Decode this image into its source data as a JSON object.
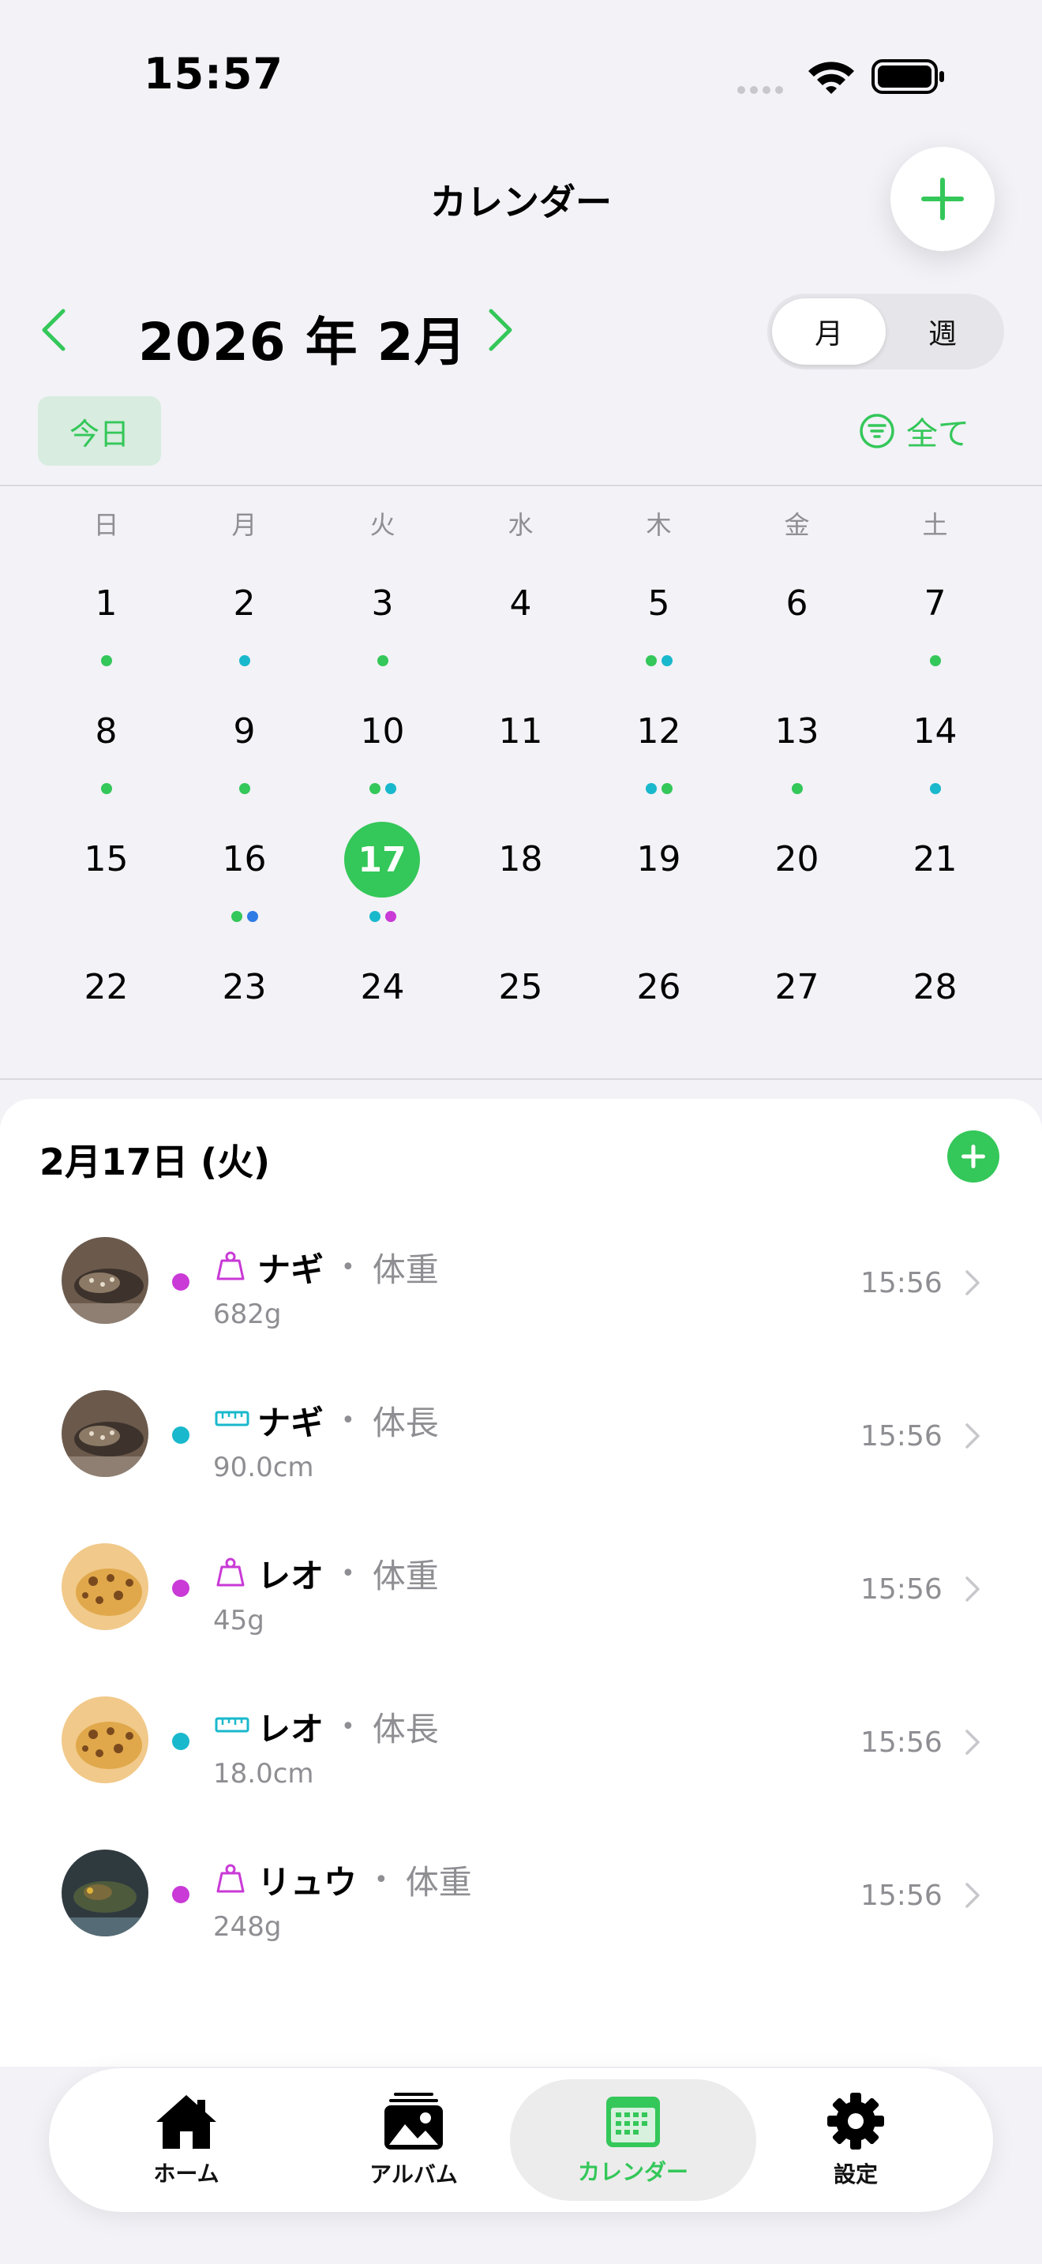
{
  "status_bar": {
    "time": "15:57"
  },
  "header": {
    "title": "カレンダー"
  },
  "month_nav": {
    "title": "2026 年 2月",
    "view_toggle": [
      "月",
      "週"
    ],
    "active_view": "月"
  },
  "toolbar": {
    "today_label": "今日",
    "filter_label": "全て"
  },
  "calendar": {
    "weekdays": [
      "日",
      "月",
      "火",
      "水",
      "木",
      "金",
      "土"
    ],
    "selected_day": "17",
    "days": [
      {
        "d": "1",
        "dots": [
          "green"
        ]
      },
      {
        "d": "2",
        "dots": [
          "cyan"
        ]
      },
      {
        "d": "3",
        "dots": [
          "green"
        ]
      },
      {
        "d": "4",
        "dots": []
      },
      {
        "d": "5",
        "dots": [
          "green",
          "cyan"
        ]
      },
      {
        "d": "6",
        "dots": []
      },
      {
        "d": "7",
        "dots": [
          "green"
        ]
      },
      {
        "d": "8",
        "dots": [
          "green"
        ]
      },
      {
        "d": "9",
        "dots": [
          "green"
        ]
      },
      {
        "d": "10",
        "dots": [
          "green",
          "cyan"
        ]
      },
      {
        "d": "11",
        "dots": []
      },
      {
        "d": "12",
        "dots": [
          "cyan",
          "green"
        ]
      },
      {
        "d": "13",
        "dots": [
          "green"
        ]
      },
      {
        "d": "14",
        "dots": [
          "cyan"
        ]
      },
      {
        "d": "15",
        "dots": []
      },
      {
        "d": "16",
        "dots": [
          "green",
          "blue"
        ]
      },
      {
        "d": "17",
        "dots": [
          "cyan",
          "magenta"
        ]
      },
      {
        "d": "18",
        "dots": []
      },
      {
        "d": "19",
        "dots": []
      },
      {
        "d": "20",
        "dots": []
      },
      {
        "d": "21",
        "dots": []
      },
      {
        "d": "22",
        "dots": []
      },
      {
        "d": "23",
        "dots": []
      },
      {
        "d": "24",
        "dots": []
      },
      {
        "d": "25",
        "dots": []
      },
      {
        "d": "26",
        "dots": []
      },
      {
        "d": "27",
        "dots": []
      },
      {
        "d": "28",
        "dots": []
      }
    ]
  },
  "colors": {
    "accent": "#34c759",
    "green": "#34c759",
    "cyan": "#19b8cc",
    "blue": "#2f7be5",
    "magenta": "#c93ad6"
  },
  "day_sheet": {
    "title": "2月17日 (火)",
    "records": [
      {
        "name": "ナギ",
        "type": "体重",
        "value": "682g",
        "time": "15:56",
        "kind": "weight",
        "avatar": "dark-gecko"
      },
      {
        "name": "ナギ",
        "type": "体長",
        "value": "90.0cm",
        "time": "15:56",
        "kind": "length",
        "avatar": "dark-gecko"
      },
      {
        "name": "レオ",
        "type": "体重",
        "value": "45g",
        "time": "15:56",
        "kind": "weight",
        "avatar": "leopard-gecko"
      },
      {
        "name": "レオ",
        "type": "体長",
        "value": "18.0cm",
        "time": "15:56",
        "kind": "length",
        "avatar": "leopard-gecko"
      },
      {
        "name": "リュウ",
        "type": "体重",
        "value": "248g",
        "time": "15:56",
        "kind": "weight",
        "avatar": "green-lizard"
      }
    ]
  },
  "tabbar": {
    "items": [
      {
        "label": "ホーム",
        "icon": "home-icon"
      },
      {
        "label": "アルバム",
        "icon": "album-icon"
      },
      {
        "label": "カレンダー",
        "icon": "calendar-icon"
      },
      {
        "label": "設定",
        "icon": "gear-icon"
      }
    ],
    "active": 2
  }
}
